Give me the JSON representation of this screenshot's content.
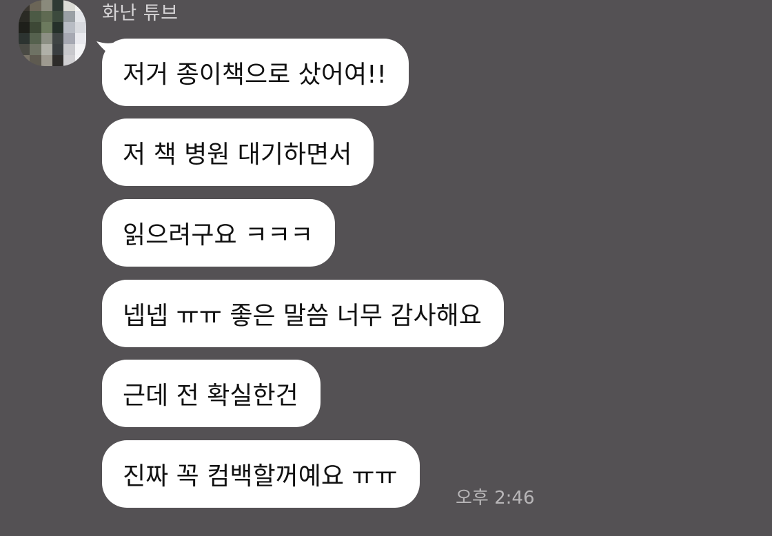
{
  "chat": {
    "sender": "화난 튜브",
    "avatar": {
      "pixel_colors": [
        "#3a3630",
        "#6b6557",
        "#8a8a7c",
        "#2f3a34",
        "#dcdcd6",
        "#f2f2f0",
        "#2a2a24",
        "#4c5a45",
        "#5f6a52",
        "#3c4a3d",
        "#9aa0a5",
        "#e4e6ea",
        "#1e1f1a",
        "#3d4836",
        "#6c7a5e",
        "#25302a",
        "#b8bcc4",
        "#d8dadf",
        "#2c3330",
        "#55614e",
        "#8c8f84",
        "#3f4444",
        "#a6a8b2",
        "#e9e9ee",
        "#4a4a44",
        "#6e7264",
        "#b0b0a8",
        "#3a3e40",
        "#c8c8cc",
        "#f4f4f6",
        "#7a7468",
        "#5e5a50",
        "#9e9a90",
        "#2e2c2a",
        "#d0cfd2",
        "#f6f6f8"
      ]
    },
    "messages": [
      {
        "text": "저거 종이책으로 샀어여!!"
      },
      {
        "text": "저 책 병원 대기하면서"
      },
      {
        "text": "읽으려구요 ㅋㅋㅋ"
      },
      {
        "text": "넵넵 ㅠㅠ 좋은 말씀 너무 감사해요"
      },
      {
        "text": "근데 전 확실한건"
      },
      {
        "text": "진짜 꼭 컴백할꺼예요 ㅠㅠ"
      }
    ],
    "timestamp": "오후 2:46"
  },
  "colors": {
    "background": "#545154",
    "bubble": "#ffffff",
    "bubble_text": "#111111",
    "sender_name": "#d6d4d6",
    "timestamp": "#b8b6b8"
  }
}
